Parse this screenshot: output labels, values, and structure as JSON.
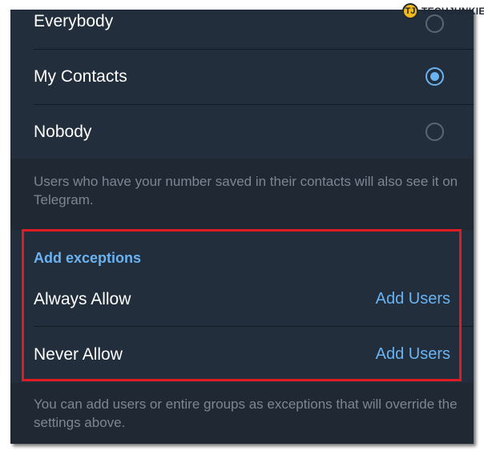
{
  "visibility_options": [
    {
      "label": "Everybody",
      "selected": false
    },
    {
      "label": "My Contacts",
      "selected": true
    },
    {
      "label": "Nobody",
      "selected": false
    }
  ],
  "visibility_note": "Users who have your number saved in their contacts will also see it on Telegram.",
  "exceptions": {
    "title": "Add exceptions",
    "always_allow": {
      "label": "Always Allow",
      "action": "Add Users"
    },
    "never_allow": {
      "label": "Never Allow",
      "action": "Add Users"
    }
  },
  "exceptions_note": "You can add users or entire groups as exceptions that will override the settings above.",
  "watermark": {
    "logo_letters": "TJ",
    "text": "TECHJUNKIE"
  },
  "colors": {
    "background": "#1f2833",
    "card": "#222e3b",
    "accent": "#6ab3f3",
    "highlight": "#e01b24",
    "note_text": "#7c8793"
  }
}
